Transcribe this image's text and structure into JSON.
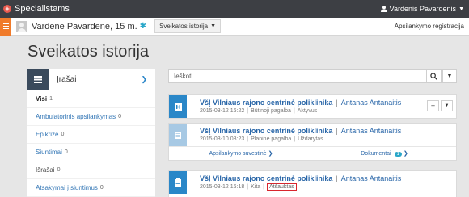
{
  "app": {
    "brand": "Specialistams",
    "user_name": "Vardenis Pavardenis"
  },
  "patient": {
    "name": "Vardenė Pavardenė, 15 m.",
    "section_dropdown": "Sveikatos istorija",
    "visit_link": "Apsilankymo registracija"
  },
  "page": {
    "title": "Sveikatos istorija"
  },
  "left_panel": {
    "title": "Įrašai",
    "items": [
      {
        "label": "Visi",
        "count": "1"
      },
      {
        "label": "Ambulatorinis apsilankymas",
        "count": "0"
      },
      {
        "label": "Epikrizė",
        "count": "0"
      },
      {
        "label": "Siuntimai",
        "count": "0"
      },
      {
        "label": "Išrašai",
        "count": "0"
      },
      {
        "label": "Atsakymai į siuntimus",
        "count": "0"
      }
    ]
  },
  "search": {
    "placeholder": "Ieškoti"
  },
  "cards": [
    {
      "institution": "VšĮ Vilniaus rajono centrinė poliklinika",
      "doctor": "Antanas Antanaitis",
      "datetime": "2015-03-12 16:22",
      "type": "Būtinoji pagalba",
      "status": "Aktyvus"
    },
    {
      "institution": "VšĮ Vilniaus rajono centrinė poliklinika",
      "doctor": "Antanas Antanaitis",
      "datetime": "2015-03-10 08:23",
      "type": "Planinė pagalba",
      "status": "Uždarytas",
      "footer_summary": "Apsilankymo suvestinė",
      "footer_documents": "Dokumentai",
      "documents_count": "1"
    },
    {
      "institution": "VšĮ Vilniaus rajono centrinė poliklinika",
      "doctor": "Antanas Antanaitis",
      "datetime": "2015-03-12 16:18",
      "type": "Kita",
      "status": "Atšauktas"
    }
  ],
  "colors": {
    "topbar": "#3d3f44",
    "accent_orange": "#f07b2b",
    "primary_blue": "#2a87c8",
    "link_blue": "#2966a8",
    "cancel_red": "#d9262e"
  },
  "icons": {
    "brand": "medical-cross-icon",
    "user": "user-icon",
    "menu": "hamburger-icon",
    "favorite": "star-icon",
    "list": "list-icon",
    "search": "search-icon",
    "visit_emergency": "hospital-icon",
    "visit_planned": "document-icon",
    "visit_other": "clipboard-icon"
  }
}
